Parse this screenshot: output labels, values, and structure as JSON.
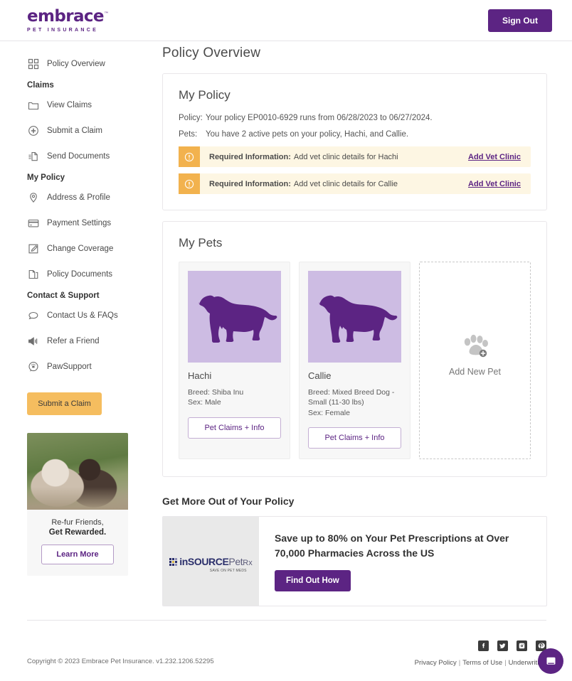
{
  "header": {
    "logo_main": "embrace",
    "logo_tm": "™",
    "logo_sub": "PET INSURANCE",
    "sign_out": "Sign Out"
  },
  "sidebar": {
    "top_item": {
      "label": "Policy Overview",
      "icon": "grid-icon"
    },
    "groups": [
      {
        "title": "Claims",
        "items": [
          {
            "label": "View Claims",
            "icon": "folder-icon"
          },
          {
            "label": "Submit a Claim",
            "icon": "plus-circle-icon"
          },
          {
            "label": "Send Documents",
            "icon": "send-document-icon"
          }
        ]
      },
      {
        "title": "My Policy",
        "items": [
          {
            "label": "Address & Profile",
            "icon": "location-pin-icon"
          },
          {
            "label": "Payment Settings",
            "icon": "credit-card-icon"
          },
          {
            "label": "Change Coverage",
            "icon": "pencil-edit-icon"
          },
          {
            "label": "Policy Documents",
            "icon": "documents-icon"
          }
        ]
      },
      {
        "title": "Contact & Support",
        "items": [
          {
            "label": "Contact Us & FAQs",
            "icon": "speech-bubble-icon"
          },
          {
            "label": "Refer a Friend",
            "icon": "megaphone-icon"
          },
          {
            "label": "PawSupport",
            "icon": "paw-circle-icon"
          }
        ]
      }
    ],
    "submit_claim_button": "Submit a Claim",
    "refer_promo": {
      "line1": "Re-fur Friends,",
      "line2": "Get Rewarded.",
      "button": "Learn More"
    }
  },
  "main": {
    "page_title": "Policy Overview",
    "policy_card": {
      "title": "My Policy",
      "rows": [
        {
          "label": "Policy:",
          "value": "Your policy EP0010-6929 runs from 06/28/2023 to 06/27/2024."
        },
        {
          "label": "Pets:",
          "value": "You have 2 active pets on your policy, Hachi, and Callie."
        }
      ],
      "alerts": [
        {
          "strong": "Required Information:",
          "text": "Add vet clinic details for Hachi",
          "link": "Add Vet Clinic"
        },
        {
          "strong": "Required Information:",
          "text": "Add vet clinic details for Callie",
          "link": "Add Vet Clinic"
        }
      ]
    },
    "pets_card": {
      "title": "My Pets",
      "pets": [
        {
          "name": "Hachi",
          "breed_label": "Breed:",
          "breed": "Shiba Inu",
          "sex_label": "Sex:",
          "sex": "Male",
          "button": "Pet Claims + Info"
        },
        {
          "name": "Callie",
          "breed_label": "Breed:",
          "breed": "Mixed Breed Dog - Small (11-30 lbs)",
          "sex_label": "Sex:",
          "sex": "Female",
          "button": "Pet Claims + Info"
        }
      ],
      "add_pet": {
        "label": "Add New Pet",
        "icon": "paw-plus-icon"
      }
    },
    "promo": {
      "section_title": "Get More Out of Your Policy",
      "logo_in": "inSOURCE",
      "logo_pet": "Pet",
      "logo_rx": "Rx",
      "logo_tagline": "SAVE ON PET MEDS",
      "headline": "Save up to 80% on Your Pet Prescriptions at Over 70,000 Pharmacies Across the US",
      "button": "Find Out How"
    }
  },
  "footer": {
    "copyright": "Copyright © 2023  Embrace Pet Insurance. v1.232.1206.52295",
    "socials": [
      "facebook-icon",
      "twitter-icon",
      "instagram-icon",
      "pinterest-icon"
    ],
    "links": [
      "Privacy Policy",
      "Terms of Use",
      "Underwriting"
    ],
    "separator": "|"
  },
  "colors": {
    "brand_purple": "#5c2483",
    "alert_orange": "#f2b24e",
    "alert_bg": "#fdf6e3",
    "accent_yellow": "#f5bd5f",
    "pet_photo_bg": "#cdbce3"
  }
}
